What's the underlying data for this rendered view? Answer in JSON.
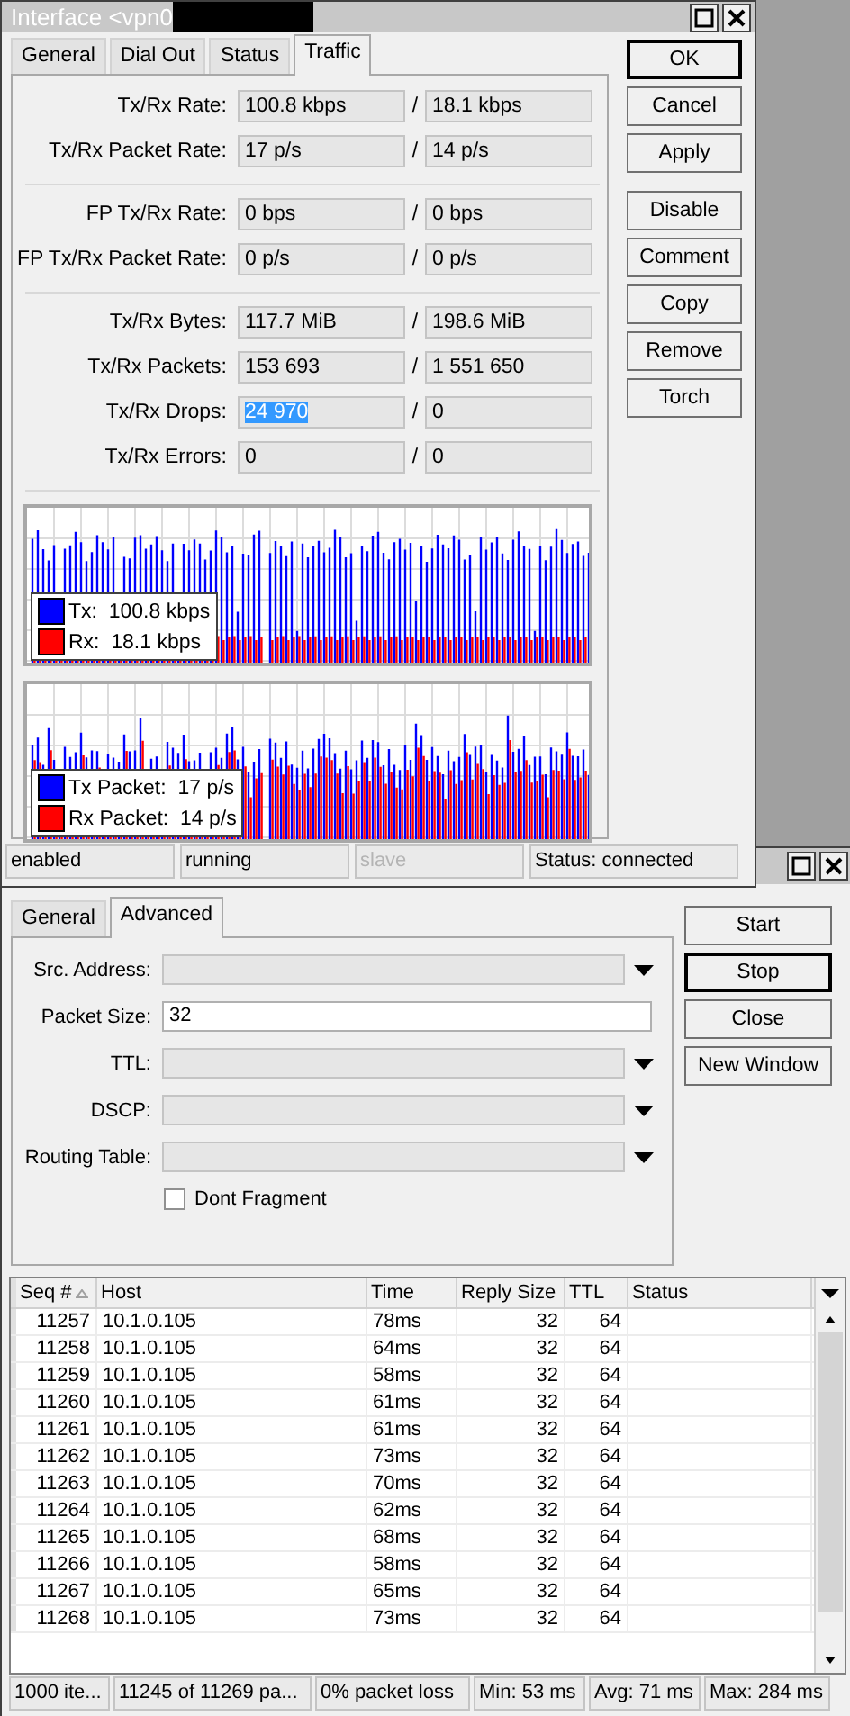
{
  "interface_window": {
    "title": "Interface <vpn0",
    "tabs": [
      {
        "label": "General",
        "selected": false
      },
      {
        "label": "Dial Out",
        "selected": false
      },
      {
        "label": "Status",
        "selected": false
      },
      {
        "label": "Traffic",
        "selected": true
      }
    ],
    "groups": [
      {
        "rows": [
          {
            "label": "Tx/Rx Rate:",
            "separator": "/",
            "values": [
              {
                "text": "100.8 kbps",
                "selected": false
              },
              {
                "text": "18.1 kbps",
                "selected": false
              }
            ]
          },
          {
            "label": "Tx/Rx Packet Rate:",
            "separator": "/",
            "values": [
              {
                "text": "17 p/s",
                "selected": false
              },
              {
                "text": "14 p/s",
                "selected": false
              }
            ]
          }
        ]
      },
      {
        "rows": [
          {
            "label": "FP Tx/Rx Rate:",
            "separator": "/",
            "values": [
              {
                "text": "0 bps",
                "selected": false
              },
              {
                "text": "0 bps",
                "selected": false
              }
            ]
          },
          {
            "label": "FP Tx/Rx Packet Rate:",
            "separator": "/",
            "values": [
              {
                "text": "0 p/s",
                "selected": false
              },
              {
                "text": "0 p/s",
                "selected": false
              }
            ]
          }
        ]
      },
      {
        "rows": [
          {
            "label": "Tx/Rx Bytes:",
            "separator": "/",
            "values": [
              {
                "text": "117.7 MiB",
                "selected": false
              },
              {
                "text": "198.6 MiB",
                "selected": false
              }
            ]
          },
          {
            "label": "Tx/Rx Packets:",
            "separator": "/",
            "values": [
              {
                "text": "153 693",
                "selected": false
              },
              {
                "text": "1 551 650",
                "selected": false
              }
            ]
          },
          {
            "label": "Tx/Rx Drops:",
            "separator": "/",
            "values": [
              {
                "text": "24 970",
                "selected": true
              },
              {
                "text": "0",
                "selected": false
              }
            ]
          },
          {
            "label": "Tx/Rx Errors:",
            "separator": "/",
            "values": [
              {
                "text": "0",
                "selected": false
              },
              {
                "text": "0",
                "selected": false
              }
            ]
          }
        ]
      }
    ],
    "graphs": [
      {
        "kind": "rate",
        "legend": [
          {
            "label": "Tx:  100.8 kbps",
            "color": "#0000ff"
          },
          {
            "label": "Rx:  18.1 kbps",
            "color": "#ff0000"
          }
        ]
      },
      {
        "kind": "packet",
        "legend": [
          {
            "label": "Tx Packet:  17 p/s",
            "color": "#0000ff"
          },
          {
            "label": "Rx Packet:  14 p/s",
            "color": "#ff0000"
          }
        ]
      }
    ],
    "button_groups": [
      [
        {
          "label": "OK",
          "default": true
        },
        {
          "label": "Cancel",
          "default": false
        },
        {
          "label": "Apply",
          "default": false
        }
      ],
      [
        {
          "label": "Disable",
          "default": false
        },
        {
          "label": "Comment",
          "default": false
        },
        {
          "label": "Copy",
          "default": false
        },
        {
          "label": "Remove",
          "default": false
        },
        {
          "label": "Torch",
          "default": false
        }
      ]
    ],
    "status_bar": [
      {
        "text": "enabled",
        "disabled": false
      },
      {
        "text": "running",
        "disabled": false
      },
      {
        "text": "slave",
        "disabled": true
      },
      {
        "text": "Status: connected",
        "disabled": false
      }
    ]
  },
  "ping_window": {
    "tabs": [
      {
        "label": "General",
        "selected": false
      },
      {
        "label": "Advanced",
        "selected": true
      }
    ],
    "fields": [
      {
        "label": "Src. Address:",
        "kind": "dropdown"
      },
      {
        "label": "Packet Size:",
        "kind": "text",
        "value": "32"
      },
      {
        "label": "TTL:",
        "kind": "dropdown"
      },
      {
        "label": "DSCP:",
        "kind": "dropdown"
      },
      {
        "label": "Routing Table:",
        "kind": "dropdown"
      }
    ],
    "checkbox": {
      "label": "Dont Fragment",
      "checked": false
    },
    "buttons": [
      {
        "label": "Start",
        "default": false
      },
      {
        "label": "Stop",
        "default": true
      },
      {
        "label": "Close",
        "default": false
      },
      {
        "label": "New Window",
        "default": false
      }
    ],
    "table": {
      "columns": [
        {
          "label": "Seq #",
          "sorted": true
        },
        {
          "label": "Host",
          "sorted": false
        },
        {
          "label": "Time",
          "sorted": false
        },
        {
          "label": "Reply Size",
          "sorted": false
        },
        {
          "label": "TTL",
          "sorted": false
        },
        {
          "label": "Status",
          "sorted": false
        }
      ],
      "rows": [
        [
          "11257",
          "10.1.0.105",
          "78ms",
          "32",
          "64"
        ],
        [
          "11258",
          "10.1.0.105",
          "64ms",
          "32",
          "64"
        ],
        [
          "11259",
          "10.1.0.105",
          "58ms",
          "32",
          "64"
        ],
        [
          "11260",
          "10.1.0.105",
          "61ms",
          "32",
          "64"
        ],
        [
          "11261",
          "10.1.0.105",
          "61ms",
          "32",
          "64"
        ],
        [
          "11262",
          "10.1.0.105",
          "73ms",
          "32",
          "64"
        ],
        [
          "11263",
          "10.1.0.105",
          "70ms",
          "32",
          "64"
        ],
        [
          "11264",
          "10.1.0.105",
          "62ms",
          "32",
          "64"
        ],
        [
          "11265",
          "10.1.0.105",
          "68ms",
          "32",
          "64"
        ],
        [
          "11266",
          "10.1.0.105",
          "58ms",
          "32",
          "64"
        ],
        [
          "11267",
          "10.1.0.105",
          "65ms",
          "32",
          "64"
        ],
        [
          "11268",
          "10.1.0.105",
          "73ms",
          "32",
          "64"
        ]
      ]
    },
    "status_bar": [
      "1000 ite...",
      "11245 of 11269 pa...",
      "0% packet loss",
      "Min: 53 ms",
      "Avg: 71 ms",
      "Max: 284 ms"
    ]
  }
}
